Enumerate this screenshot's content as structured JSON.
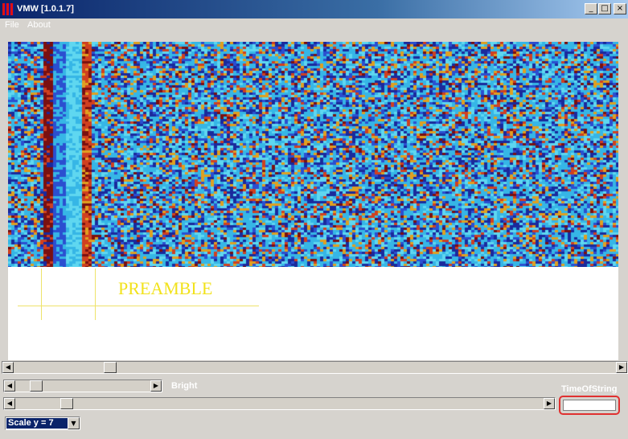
{
  "window": {
    "title": "VMW [1.0.1.7]"
  },
  "window_buttons": {
    "minimize": "_",
    "maximize": "□",
    "close": "×"
  },
  "menu": {
    "items": [
      "File",
      "About"
    ]
  },
  "plot": {
    "annotation": "PREAMBLE",
    "palette": [
      "#1a2a9c",
      "#2b4fd0",
      "#36b6e6",
      "#5fd7f0",
      "#e0a020",
      "#d04020",
      "#7a1010"
    ]
  },
  "controls": {
    "bright_label": "Bright",
    "time_label": "TimeOfString",
    "time_value": "",
    "scale_selected": "Scale y = 7"
  },
  "scroll_arrows": {
    "left": "◀",
    "right": "▶",
    "down": "▼"
  }
}
